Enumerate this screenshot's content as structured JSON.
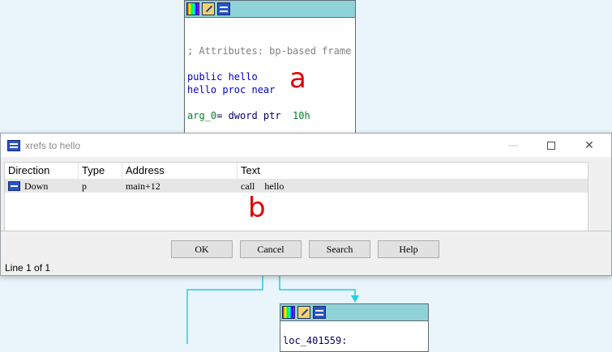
{
  "top_node": {
    "icons": [
      "color-palette-icon",
      "edit-pencil-icon",
      "graph-icon"
    ],
    "lines": {
      "comment": "; Attributes: bp-based frame",
      "public": "public hello",
      "proc": "hello proc near",
      "arg_name": "arg_0",
      "arg_mid": "= dword ptr  ",
      "arg_val": "10h"
    }
  },
  "bottom_node": {
    "icons": [
      "color-palette-icon",
      "edit-pencil-icon",
      "graph-icon"
    ],
    "label": "loc_401559:"
  },
  "annotations": {
    "a": "a",
    "b": "b"
  },
  "colors": {
    "graph_background": "#e9f5fb",
    "node_header": "#8fd3d8",
    "edge": "#20d0e8",
    "annotation": "#e00000"
  },
  "dialog": {
    "title": "xrefs to hello",
    "window_buttons": {
      "minimize": "—",
      "close": "✕"
    },
    "columns": [
      "Direction",
      "Type",
      "Address",
      "Text"
    ],
    "rows": [
      {
        "direction": "Down",
        "type": "p",
        "address": "main+12",
        "text": "call    hello"
      }
    ],
    "buttons": {
      "ok": "OK",
      "cancel": "Cancel",
      "search": "Search",
      "help": "Help"
    },
    "status": "Line 1 of 1"
  }
}
